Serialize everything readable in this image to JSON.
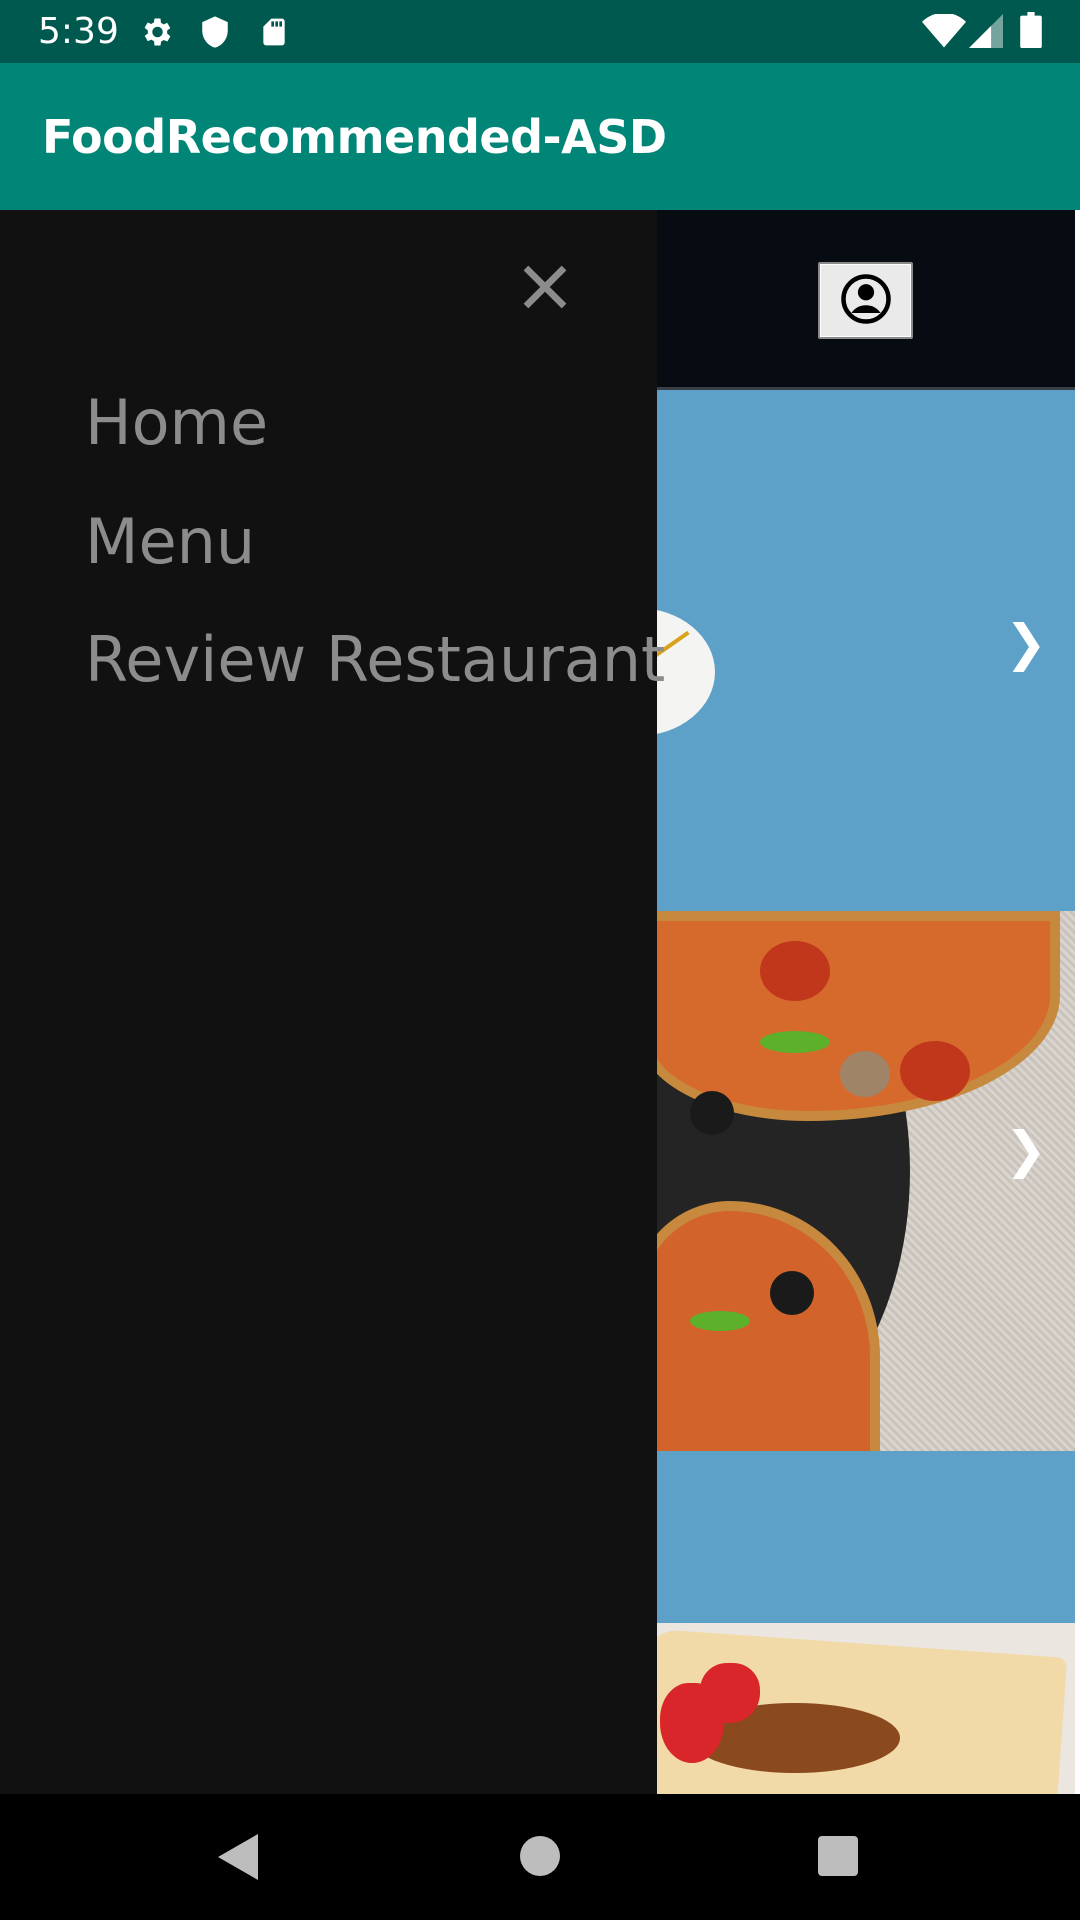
{
  "status_bar": {
    "time": "5:39",
    "icons": [
      "settings-icon",
      "shield-icon",
      "sd-card-icon",
      "wifi-icon",
      "signal-icon",
      "battery-icon"
    ]
  },
  "app_bar": {
    "title": "FoodRecommended-ASD",
    "color": "#008577"
  },
  "drawer": {
    "close_icon": "close-icon",
    "items": [
      {
        "label": "Home"
      },
      {
        "label": "Menu"
      },
      {
        "label": "Review Restaurant"
      }
    ]
  },
  "content": {
    "profile_icon": "account-circle-icon",
    "slider_next_glyph": "❯",
    "slides": [
      {
        "name": "noodles-slide",
        "background": "#5da0c8"
      },
      {
        "name": "pizza-slide"
      },
      {
        "name": "dessert-slide"
      }
    ]
  },
  "nav_bar": {
    "icons": [
      "back-icon",
      "home-icon",
      "recents-icon"
    ]
  }
}
